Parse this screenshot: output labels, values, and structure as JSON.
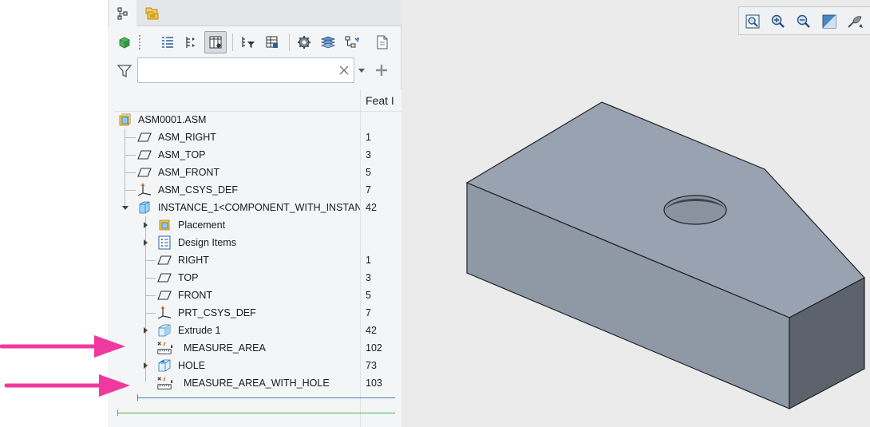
{
  "filter": {
    "value": "",
    "placeholder": ""
  },
  "tree": {
    "column_header": "Feat I",
    "rows": [
      {
        "label": "ASM0001.ASM",
        "number": "",
        "icon": "assembly-icon"
      },
      {
        "label": "ASM_RIGHT",
        "number": "1",
        "icon": "datum-plane-icon"
      },
      {
        "label": "ASM_TOP",
        "number": "3",
        "icon": "datum-plane-icon"
      },
      {
        "label": "ASM_FRONT",
        "number": "5",
        "icon": "datum-plane-icon"
      },
      {
        "label": "ASM_CSYS_DEF",
        "number": "7",
        "icon": "csys-icon"
      },
      {
        "label": "INSTANCE_1<COMPONENT_WITH_INSTANC",
        "number": "42",
        "icon": "part-icon"
      },
      {
        "label": "Placement",
        "number": "",
        "icon": "placement-icon"
      },
      {
        "label": "Design Items",
        "number": "",
        "icon": "design-items-icon"
      },
      {
        "label": "RIGHT",
        "number": "1",
        "icon": "datum-plane-icon"
      },
      {
        "label": "TOP",
        "number": "3",
        "icon": "datum-plane-icon"
      },
      {
        "label": "FRONT",
        "number": "5",
        "icon": "datum-plane-icon"
      },
      {
        "label": "PRT_CSYS_DEF",
        "number": "7",
        "icon": "csys-icon"
      },
      {
        "label": "Extrude 1",
        "number": "42",
        "icon": "extrude-icon"
      },
      {
        "label": "MEASURE_AREA",
        "number": "102",
        "icon": "measure-icon"
      },
      {
        "label": "HOLE",
        "number": "73",
        "icon": "hole-icon"
      },
      {
        "label": "MEASURE_AREA_WITH_HOLE",
        "number": "103",
        "icon": "measure-icon"
      }
    ]
  },
  "colors": {
    "annotation_arrow": "#f0399e",
    "model_face": "#98a2b0",
    "model_side": "#5c636c",
    "insert_line_blue": "#4a86b0",
    "insert_line_green": "#47b84a"
  }
}
